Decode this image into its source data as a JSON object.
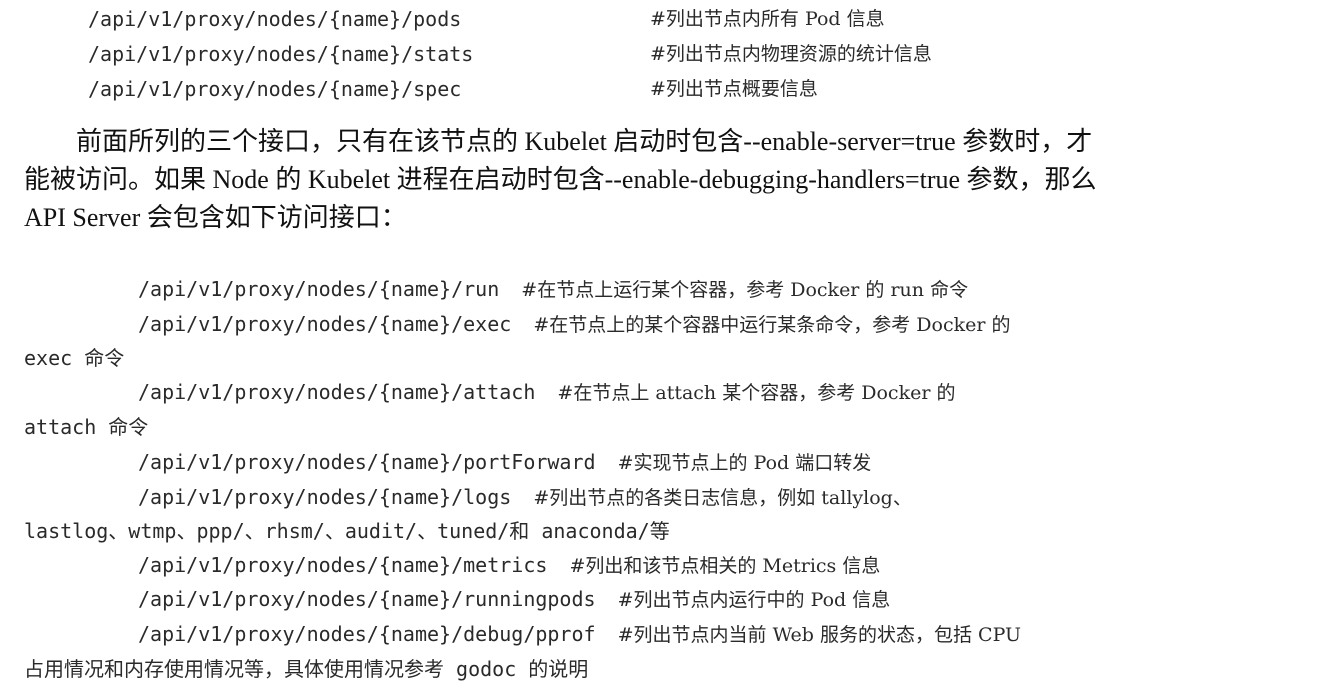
{
  "top_endpoints": [
    {
      "path": "/api/v1/proxy/nodes/{name}/pods",
      "comment": "#列出节点内所有 Pod 信息"
    },
    {
      "path": "/api/v1/proxy/nodes/{name}/stats",
      "comment": "#列出节点内物理资源的统计信息"
    },
    {
      "path": "/api/v1/proxy/nodes/{name}/spec",
      "comment": "#列出节点概要信息"
    }
  ],
  "paragraph": {
    "line1": "前面所列的三个接口，只有在该节点的 Kubelet 启动时包含--enable-server=true 参数时，才",
    "line2": "能被访问。如果 Node 的 Kubelet 进程在启动时包含--enable-debugging-handlers=true 参数，那么",
    "line3": "API Server 会包含如下访问接口："
  },
  "debug_endpoints": [
    {
      "path": "/api/v1/proxy/nodes/{name}/run",
      "comment": "#在节点上运行某个容器，参考 Docker 的 run 命令",
      "continuation": ""
    },
    {
      "path": "/api/v1/proxy/nodes/{name}/exec",
      "comment": "#在节点上的某个容器中运行某条命令，参考 Docker 的",
      "continuation": "exec 命令"
    },
    {
      "path": "/api/v1/proxy/nodes/{name}/attach",
      "comment": "#在节点上 attach 某个容器，参考 Docker 的",
      "continuation": "attach 命令"
    },
    {
      "path": "/api/v1/proxy/nodes/{name}/portForward",
      "comment": "#实现节点上的 Pod 端口转发",
      "continuation": ""
    },
    {
      "path": "/api/v1/proxy/nodes/{name}/logs",
      "comment": "#列出节点的各类日志信息，例如 tallylog、",
      "continuation": "lastlog、wtmp、ppp/、rhsm/、audit/、tuned/和 anaconda/等"
    },
    {
      "path": "/api/v1/proxy/nodes/{name}/metrics",
      "comment": "#列出和该节点相关的 Metrics 信息",
      "continuation": ""
    },
    {
      "path": "/api/v1/proxy/nodes/{name}/runningpods",
      "comment": "#列出节点内运行中的 Pod 信息",
      "continuation": ""
    },
    {
      "path": "/api/v1/proxy/nodes/{name}/debug/pprof",
      "comment": "#列出节点内当前 Web 服务的状态，包括 CPU",
      "continuation": "占用情况和内存使用情况等，具体使用情况参考 godoc 的说明"
    }
  ]
}
